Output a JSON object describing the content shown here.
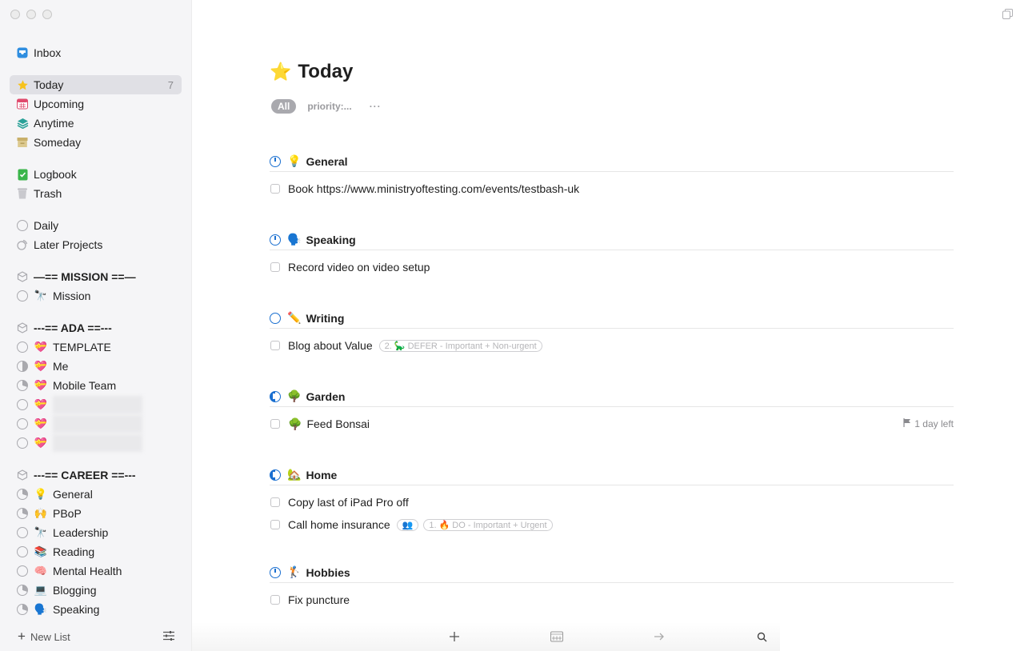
{
  "window": {
    "traffic_lights": [
      "close",
      "minimize",
      "zoom"
    ]
  },
  "sidebar": {
    "smart_lists": [
      {
        "label": "Inbox",
        "icon": "inbox-icon",
        "color": "#2f8ee0"
      },
      {
        "label": "Today",
        "icon": "star-icon",
        "color": "#f7c21b",
        "count": "7",
        "selected": true
      },
      {
        "label": "Upcoming",
        "icon": "calendar-icon",
        "color": "#e04a6d"
      },
      {
        "label": "Anytime",
        "icon": "layers-icon",
        "color": "#2aa198"
      },
      {
        "label": "Someday",
        "icon": "archive-box-icon",
        "color": "#d4bd7c"
      },
      {
        "label": "Logbook",
        "icon": "logbook-icon",
        "color": "#3ab54a"
      },
      {
        "label": "Trash",
        "icon": "trash-icon",
        "color": "#a9a9ae"
      }
    ],
    "projects": [
      {
        "label": "Daily",
        "icon": "project-ring-icon"
      },
      {
        "label": "Later Projects",
        "icon": "later-projects-icon"
      }
    ],
    "areas": [
      {
        "label": "—== MISSION ==—",
        "items": [
          {
            "label": "Mission",
            "emoji": "🔭",
            "progress": "empty"
          }
        ]
      },
      {
        "label": "---== ADA ==---",
        "items": [
          {
            "label": "TEMPLATE",
            "emoji": "💝",
            "progress": "empty"
          },
          {
            "label": "Me",
            "emoji": "💝",
            "progress": "half"
          },
          {
            "label": "Mobile Team",
            "emoji": "💝",
            "progress": "partial"
          },
          {
            "label": "",
            "emoji": "💝",
            "progress": "empty",
            "redacted": true
          },
          {
            "label": "",
            "emoji": "💝",
            "progress": "empty",
            "redacted": true
          },
          {
            "label": "",
            "emoji": "💝",
            "progress": "empty",
            "redacted": true
          }
        ]
      },
      {
        "label": "---== CAREER ==---",
        "items": [
          {
            "label": "General",
            "emoji": "💡",
            "progress": "partial"
          },
          {
            "label": "PBoP",
            "emoji": "🙌",
            "progress": "partial"
          },
          {
            "label": "Leadership",
            "emoji": "🔭",
            "progress": "empty"
          },
          {
            "label": "Reading",
            "emoji": "📚",
            "progress": "empty"
          },
          {
            "label": "Mental Health",
            "emoji": "🧠",
            "progress": "empty"
          },
          {
            "label": "Blogging",
            "emoji": "💻",
            "progress": "partial"
          },
          {
            "label": "Speaking",
            "emoji": "🗣️",
            "progress": "partial"
          }
        ]
      }
    ],
    "footer": {
      "new_list_label": "New List",
      "settings_icon": "sliders-icon"
    }
  },
  "main": {
    "title": "Today",
    "title_emoji": "⭐",
    "filters": {
      "all_label": "All",
      "tag_label": "priority:...",
      "more_label": "···"
    },
    "sections": [
      {
        "name": "General",
        "emoji": "💡",
        "ring": "clock",
        "tasks": [
          {
            "title": "Book https://www.ministryoftesting.com/events/testbash-uk"
          }
        ]
      },
      {
        "name": "Speaking",
        "emoji": "🗣️",
        "ring": "clock",
        "tasks": [
          {
            "title": "Record video on video setup"
          }
        ]
      },
      {
        "name": "Writing",
        "emoji": "✏️",
        "ring": "empty",
        "tasks": [
          {
            "title": "Blog about Value",
            "tags": [
              "2. 🦕 DEFER - Important + Non-urgent"
            ]
          }
        ]
      },
      {
        "name": "Garden",
        "emoji": "🌳",
        "ring": "halfmoon",
        "tasks": [
          {
            "title": "Feed Bonsai",
            "emoji": "🌳",
            "deadline": "1 day left"
          }
        ]
      },
      {
        "name": "Home",
        "emoji": "🏡",
        "ring": "halfmoon",
        "tasks": [
          {
            "title": "Copy last of iPad Pro off"
          },
          {
            "title": "Call home insurance",
            "tags": [
              "👥",
              "1. 🔥 DO - Important + Urgent"
            ]
          }
        ]
      },
      {
        "name": "Hobbies",
        "emoji": "🏌️",
        "ring": "clock",
        "tasks": [
          {
            "title": "Fix puncture"
          }
        ]
      }
    ]
  },
  "toolbar": {
    "buttons": [
      {
        "name": "new-todo-button",
        "glyph": "+"
      },
      {
        "name": "when-button",
        "glyph": "calendar"
      },
      {
        "name": "move-button",
        "glyph": "→"
      },
      {
        "name": "quick-find-button",
        "glyph": "search"
      }
    ]
  }
}
